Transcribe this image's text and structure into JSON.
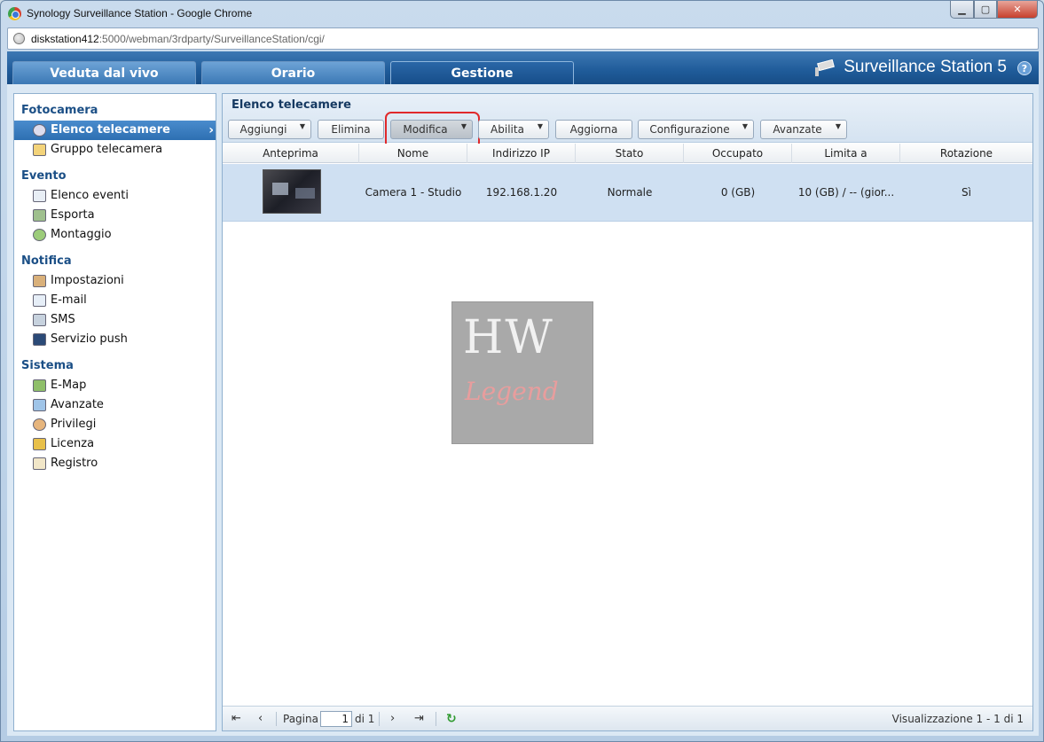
{
  "window": {
    "title": "Synology Surveillance Station - Google Chrome",
    "minimize": "▁",
    "maximize": "▢",
    "close": "✕"
  },
  "address": {
    "host": "diskstation412",
    "path": ":5000/webman/3rdparty/SurveillanceStation/cgi/"
  },
  "nav": {
    "tabs": [
      {
        "label": "Veduta dal vivo",
        "active": false
      },
      {
        "label": "Orario",
        "active": false
      },
      {
        "label": "Gestione",
        "active": true
      }
    ],
    "brand": "Surveillance Station 5",
    "help": "?"
  },
  "sidebar": {
    "sections": [
      {
        "title": "Fotocamera",
        "items": [
          {
            "label": "Elenco telecamere",
            "selected": true
          },
          {
            "label": "Gruppo telecamera"
          }
        ]
      },
      {
        "title": "Evento",
        "items": [
          {
            "label": "Elenco eventi"
          },
          {
            "label": "Esporta"
          },
          {
            "label": "Montaggio"
          }
        ]
      },
      {
        "title": "Notifica",
        "items": [
          {
            "label": "Impostazioni"
          },
          {
            "label": "E-mail"
          },
          {
            "label": "SMS"
          },
          {
            "label": "Servizio push"
          }
        ]
      },
      {
        "title": "Sistema",
        "items": [
          {
            "label": "E-Map"
          },
          {
            "label": "Avanzate"
          },
          {
            "label": "Privilegi"
          },
          {
            "label": "Licenza"
          },
          {
            "label": "Registro"
          }
        ]
      }
    ]
  },
  "main": {
    "title": "Elenco telecamere",
    "toolbar": {
      "add": "Aggiungi",
      "delete": "Elimina",
      "edit": "Modifica",
      "enable": "Abilita",
      "refresh": "Aggiorna",
      "config": "Configurazione",
      "advanced": "Avanzate"
    },
    "columns": [
      "Anteprima",
      "Nome",
      "Indirizzo IP",
      "Stato",
      "Occupato",
      "Limita a",
      "Rotazione"
    ],
    "rows": [
      {
        "name": "Camera 1 - Studio",
        "ip": "192.168.1.20",
        "status": "Normale",
        "used": "0 (GB)",
        "limit": "10 (GB) / -- (gior...",
        "rotation": "Sì"
      }
    ],
    "watermark": {
      "top": "HW",
      "bottom": "Legend"
    },
    "pager": {
      "page_label": "Pagina",
      "page": "1",
      "of": "di 1",
      "info": "Visualizzazione 1 - 1 di 1"
    }
  }
}
